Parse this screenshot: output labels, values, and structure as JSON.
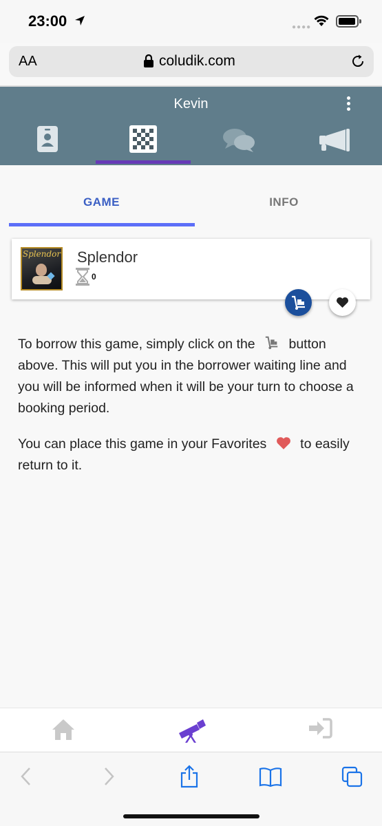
{
  "status_bar": {
    "time": "23:00"
  },
  "browser": {
    "text_size_label": "AA",
    "domain": "coludik.com"
  },
  "app_header": {
    "title": "Kevin"
  },
  "tabs": [
    {
      "label": "GAME"
    },
    {
      "label": "INFO"
    }
  ],
  "game": {
    "name": "Splendor",
    "cover_title": "Splendor",
    "waiting_count": "0"
  },
  "instructions": {
    "p1_before": "To borrow this game, simply click on the",
    "p1_after": "button above. This will put you in the borrower waiting line and you will be informed when it will be your turn to choose a booking period.",
    "p2_before": "You can place this game in your Favorites",
    "p2_after": "to easily return to it."
  },
  "colors": {
    "header_bg": "#607d8b",
    "accent_purple": "#673ab7",
    "tab_active": "#3b5fc4",
    "borrow_button": "#1b4f9c",
    "heart_red": "#e05a5a",
    "ios_blue": "#1a73e8"
  },
  "icons": {
    "header_nav": [
      "id-badge-icon",
      "chessboard-icon",
      "comments-icon",
      "megaphone-icon"
    ],
    "bottom_nav": [
      "home-icon",
      "telescope-icon",
      "sign-in-icon"
    ],
    "safari": [
      "back-icon",
      "forward-icon",
      "share-icon",
      "bookmarks-icon",
      "tabs-icon"
    ]
  }
}
